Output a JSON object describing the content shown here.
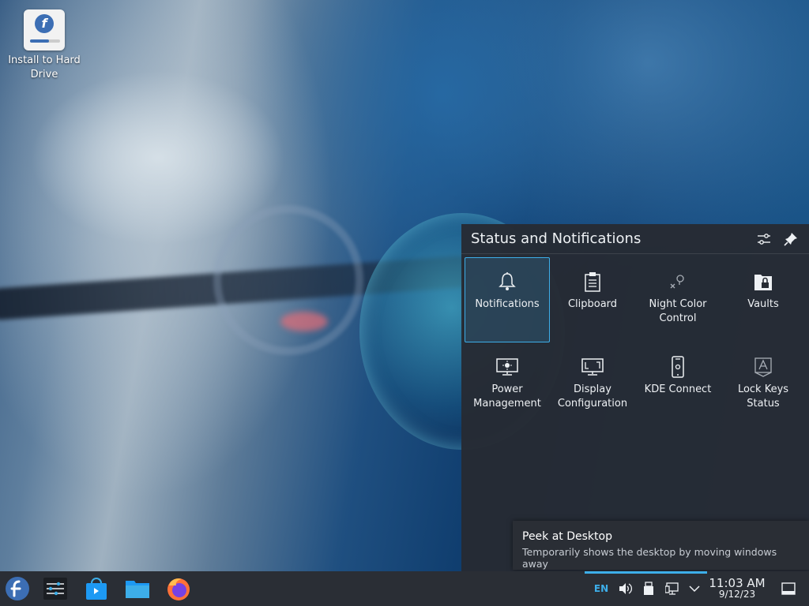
{
  "desktop": {
    "icons": [
      {
        "label": "Install to Hard Drive",
        "icon": "fedora-installer-icon"
      }
    ]
  },
  "status_panel": {
    "title": "Status and Notifications",
    "header_buttons": [
      {
        "name": "configure-icon"
      },
      {
        "name": "pin-icon"
      }
    ],
    "items": [
      {
        "label": "Notifications",
        "icon": "bell-icon",
        "active": true
      },
      {
        "label": "Clipboard",
        "icon": "clipboard-icon"
      },
      {
        "label": "Night Color Control",
        "icon": "night-color-icon"
      },
      {
        "label": "Vaults",
        "icon": "vault-icon"
      },
      {
        "label": "Power Management",
        "icon": "power-management-icon"
      },
      {
        "label": "Display Configuration",
        "icon": "display-configuration-icon"
      },
      {
        "label": "KDE Connect",
        "icon": "kde-connect-icon"
      },
      {
        "label": "Lock Keys Status",
        "icon": "lock-keys-icon"
      }
    ]
  },
  "tooltip": {
    "title": "Peek at Desktop",
    "description": "Temporarily shows the desktop by moving windows away"
  },
  "taskbar": {
    "launchers": [
      {
        "name": "fedora-menu-icon"
      },
      {
        "name": "system-settings-icon"
      },
      {
        "name": "discover-icon"
      },
      {
        "name": "file-manager-icon"
      },
      {
        "name": "firefox-icon"
      }
    ],
    "tray": {
      "keyboard_layout": "EN",
      "clock_time": "11:03 AM",
      "clock_date": "9/12/23"
    }
  },
  "colors": {
    "accent": "#3daee9",
    "panel_bg": "#262b33",
    "taskbar_bg": "#2a2e35",
    "fedora_blue": "#3c6eb4"
  }
}
